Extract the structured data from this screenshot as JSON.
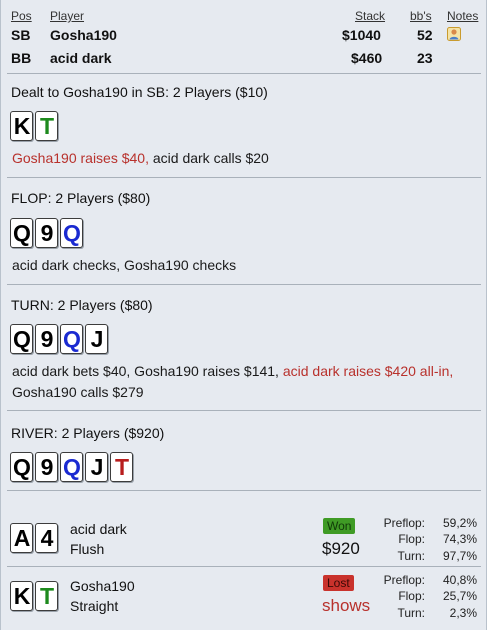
{
  "table": {
    "headers": {
      "pos": "Pos",
      "player": "Player",
      "stack": "Stack",
      "bbs": "bb's",
      "notes": "Notes"
    },
    "rows": [
      {
        "pos": "SB",
        "player": "Gosha190",
        "stack": "$1040",
        "bbs": "52",
        "note_icon": "user-note-icon"
      },
      {
        "pos": "BB",
        "player": "acid dark",
        "stack": "$460",
        "bbs": "23"
      }
    ]
  },
  "preflop": {
    "title": "Dealt to Gosha190 in SB: 2 Players ($10)",
    "hole_cards": [
      {
        "rank": "K",
        "color": "#000000"
      },
      {
        "rank": "T",
        "color": "#1d8a1d"
      }
    ],
    "action_red": "Gosha190 raises $40,",
    "action_rest": " acid dark calls $20"
  },
  "flop": {
    "title": "FLOP: 2 Players ($80)",
    "cards": [
      {
        "rank": "Q",
        "color": "#000000"
      },
      {
        "rank": "9",
        "color": "#000000"
      },
      {
        "rank": "Q",
        "color": "#1a2ad1"
      }
    ],
    "action": "acid dark checks, Gosha190 checks"
  },
  "turn": {
    "title": "TURN: 2 Players ($80)",
    "cards": [
      {
        "rank": "Q",
        "color": "#000000"
      },
      {
        "rank": "9",
        "color": "#000000"
      },
      {
        "rank": "Q",
        "color": "#1a2ad1"
      },
      {
        "rank": "J",
        "color": "#000000"
      }
    ],
    "action_a": "acid dark bets $40, Gosha190 raises $141, ",
    "action_red": "acid dark raises $420 all-in,",
    "action_b": "Gosha190 calls $279"
  },
  "river": {
    "title": "RIVER: 2 Players ($920)",
    "cards": [
      {
        "rank": "Q",
        "color": "#000000"
      },
      {
        "rank": "9",
        "color": "#000000"
      },
      {
        "rank": "Q",
        "color": "#1a2ad1"
      },
      {
        "rank": "J",
        "color": "#000000"
      },
      {
        "rank": "T",
        "color": "#b81d1d"
      }
    ]
  },
  "results": [
    {
      "cards": [
        {
          "rank": "A",
          "color": "#000000"
        },
        {
          "rank": "4",
          "color": "#000000"
        }
      ],
      "name": "acid dark",
      "hand": "Flush",
      "badge": "Won",
      "amount": "$920",
      "amount_color": "#111111",
      "stats": [
        {
          "label": "Preflop:",
          "value": "59,2%"
        },
        {
          "label": "Flop:",
          "value": "74,3%"
        },
        {
          "label": "Turn:",
          "value": "97,7%"
        }
      ]
    },
    {
      "cards": [
        {
          "rank": "K",
          "color": "#000000"
        },
        {
          "rank": "T",
          "color": "#1d8a1d"
        }
      ],
      "name": "Gosha190",
      "hand": "Straight",
      "badge": "Lost",
      "amount": "shows",
      "amount_color": "#b8312c",
      "stats": [
        {
          "label": "Preflop:",
          "value": "40,8%"
        },
        {
          "label": "Flop:",
          "value": "25,7%"
        },
        {
          "label": "Turn:",
          "value": "2,3%"
        }
      ]
    }
  ]
}
